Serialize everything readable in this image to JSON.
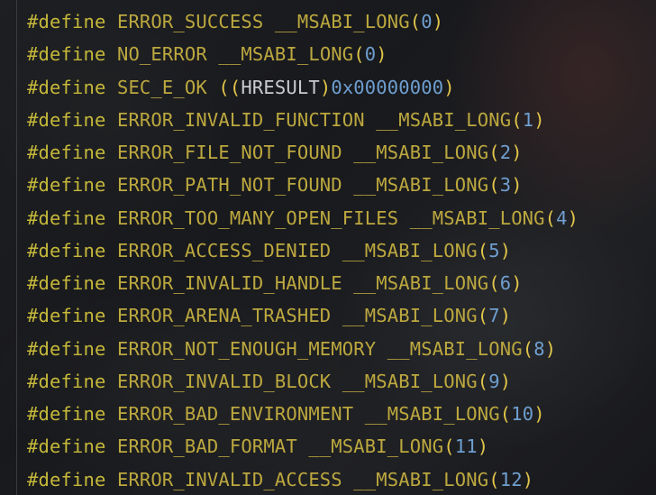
{
  "editor": {
    "lines": [
      {
        "directive": "#define",
        "name": "ERROR_SUCCESS",
        "macro": "__MSABI_LONG",
        "value": "0"
      },
      {
        "directive": "#define",
        "name": "NO_ERROR",
        "macro": "__MSABI_LONG",
        "value": "0"
      },
      {
        "directive": "#define",
        "name": "SEC_E_OK",
        "cast_open": "((",
        "cast_type": "HRESULT",
        "cast_close": ")",
        "value": "0x00000000",
        "close": ")"
      },
      {
        "directive": "#define",
        "name": "ERROR_INVALID_FUNCTION",
        "macro": "__MSABI_LONG",
        "value": "1"
      },
      {
        "directive": "#define",
        "name": "ERROR_FILE_NOT_FOUND",
        "macro": "__MSABI_LONG",
        "value": "2"
      },
      {
        "directive": "#define",
        "name": "ERROR_PATH_NOT_FOUND",
        "macro": "__MSABI_LONG",
        "value": "3"
      },
      {
        "directive": "#define",
        "name": "ERROR_TOO_MANY_OPEN_FILES",
        "macro": "__MSABI_LONG",
        "value": "4"
      },
      {
        "directive": "#define",
        "name": "ERROR_ACCESS_DENIED",
        "macro": "__MSABI_LONG",
        "value": "5"
      },
      {
        "directive": "#define",
        "name": "ERROR_INVALID_HANDLE",
        "macro": "__MSABI_LONG",
        "value": "6"
      },
      {
        "directive": "#define",
        "name": "ERROR_ARENA_TRASHED",
        "macro": "__MSABI_LONG",
        "value": "7"
      },
      {
        "directive": "#define",
        "name": "ERROR_NOT_ENOUGH_MEMORY",
        "macro": "__MSABI_LONG",
        "value": "8"
      },
      {
        "directive": "#define",
        "name": "ERROR_INVALID_BLOCK",
        "macro": "__MSABI_LONG",
        "value": "9"
      },
      {
        "directive": "#define",
        "name": "ERROR_BAD_ENVIRONMENT",
        "macro": "__MSABI_LONG",
        "value": "10"
      },
      {
        "directive": "#define",
        "name": "ERROR_BAD_FORMAT",
        "macro": "__MSABI_LONG",
        "value": "11"
      },
      {
        "directive": "#define",
        "name": "ERROR_INVALID_ACCESS",
        "macro": "__MSABI_LONG",
        "value": "12"
      }
    ]
  },
  "colors": {
    "directive": "#c5b83a",
    "identifier": "#bca83f",
    "paren": "#e0c44a",
    "number": "#6f9fd0",
    "type": "#c9cbd0"
  }
}
